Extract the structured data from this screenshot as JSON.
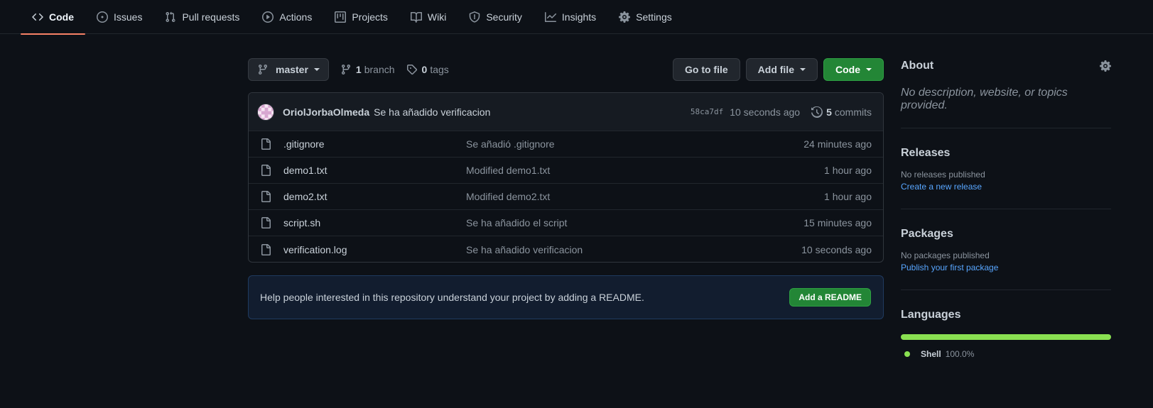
{
  "tabs": [
    {
      "label": "Code",
      "icon": "code-icon",
      "selected": true
    },
    {
      "label": "Issues",
      "icon": "issue-icon"
    },
    {
      "label": "Pull requests",
      "icon": "pull-request-icon"
    },
    {
      "label": "Actions",
      "icon": "play-icon"
    },
    {
      "label": "Projects",
      "icon": "project-icon"
    },
    {
      "label": "Wiki",
      "icon": "book-icon"
    },
    {
      "label": "Security",
      "icon": "shield-icon"
    },
    {
      "label": "Insights",
      "icon": "graph-icon"
    },
    {
      "label": "Settings",
      "icon": "gear-icon"
    }
  ],
  "file_nav": {
    "branch": "master",
    "branches_count": "1",
    "branches_label": "branch",
    "tags_count": "0",
    "tags_label": "tags",
    "go_to_file": "Go to file",
    "add_file": "Add file",
    "code": "Code"
  },
  "latest_commit": {
    "author": "OriolJorbaOlmeda",
    "message": "Se ha añadido verificacion",
    "sha": "58ca7df",
    "age": "10 seconds ago",
    "commits_count": "5",
    "commits_label": "commits"
  },
  "files": [
    {
      "name": ".gitignore",
      "message": "Se añadió .gitignore",
      "age": "24 minutes ago"
    },
    {
      "name": "demo1.txt",
      "message": "Modified demo1.txt",
      "age": "1 hour ago"
    },
    {
      "name": "demo2.txt",
      "message": "Modified demo2.txt",
      "age": "1 hour ago"
    },
    {
      "name": "script.sh",
      "message": "Se ha añadido el script",
      "age": "15 minutes ago"
    },
    {
      "name": "verification.log",
      "message": "Se ha añadido verificacion",
      "age": "10 seconds ago"
    }
  ],
  "readme": {
    "text": "Help people interested in this repository understand your project by adding a README.",
    "button": "Add a README"
  },
  "sidebar": {
    "about_title": "About",
    "about_desc": "No description, website, or topics provided.",
    "releases_title": "Releases",
    "releases_empty": "No releases published",
    "releases_link": "Create a new release",
    "packages_title": "Packages",
    "packages_empty": "No packages published",
    "packages_link": "Publish your first package",
    "languages_title": "Languages",
    "languages": [
      {
        "name": "Shell",
        "percent": "100.0%",
        "color": "#89e051"
      }
    ]
  },
  "colors": {
    "background": "#0d1117",
    "accent_tab": "#f78166",
    "primary_button": "#238636",
    "link": "#58a6ff"
  }
}
